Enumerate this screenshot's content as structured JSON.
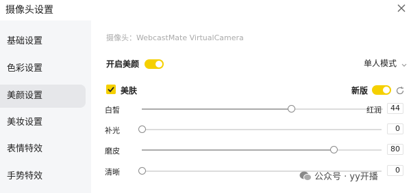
{
  "window": {
    "title": "摄像头设置"
  },
  "sidebar": {
    "items": [
      {
        "label": "基础设置",
        "active": false
      },
      {
        "label": "色彩设置",
        "active": false
      },
      {
        "label": "美颜设置",
        "active": true
      },
      {
        "label": "美妆设置",
        "active": false
      },
      {
        "label": "表情特效",
        "active": false
      },
      {
        "label": "手势特效",
        "active": false
      }
    ]
  },
  "main": {
    "camera_label": "摄像头：WebcastMate VirtualCamera",
    "beauty_toggle_label": "开启美颜",
    "beauty_toggle_on": true,
    "mode_value": "单人模式",
    "skin_label": "美肤",
    "skin_checked": true,
    "new_version_label": "新版",
    "new_version_on": true,
    "sliders": [
      {
        "label": "白皙",
        "value": "44",
        "fraction": 0.62,
        "secondary_label": "红润"
      },
      {
        "label": "补光",
        "value": "0",
        "fraction": 0.0
      },
      {
        "label": "磨皮",
        "value": "80",
        "fraction": 0.8
      },
      {
        "label": "清晰",
        "value": "0",
        "fraction": 0.0
      }
    ]
  },
  "watermark": {
    "text": "公众号 · yy开播"
  },
  "colors": {
    "accent": "#f5d000",
    "sidebar_bg": "#f5f6f8",
    "active_item_bg": "#e6e7ea"
  }
}
